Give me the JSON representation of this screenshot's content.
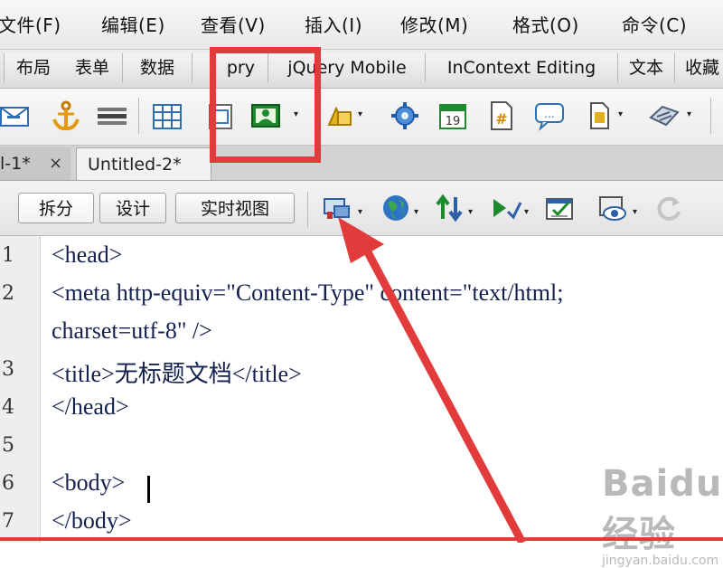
{
  "menu": [
    "文件(F)",
    "编辑(E)",
    "查看(V)",
    "插入(I)",
    "修改(M)",
    "格式(O)",
    "命令(C)"
  ],
  "insert_tabs": [
    "布局",
    "表单",
    "数据",
    "pry",
    "jQuery Mobile",
    "InContext Editing",
    "文本",
    "收藏"
  ],
  "toolbar_icons": [
    "email-link-icon",
    "named-anchor-icon",
    "horizontal-rule-icon",
    "table-icon",
    "insert-div-icon",
    "image-icon",
    "media-icon",
    "widget-icon",
    "date-icon",
    "server-side-include-icon",
    "comment-icon",
    "head-icon",
    "script-icon"
  ],
  "doc_tabs": [
    {
      "label": "l-1*",
      "close": "×"
    },
    {
      "label": "Untitled-2*"
    }
  ],
  "view_buttons": [
    "拆分",
    "设计",
    "实时视图"
  ],
  "view_icons": [
    "multiscreen-icon",
    "preview-browser-icon",
    "file-management-icon",
    "w3c-validation-icon",
    "check-browser-icon",
    "visual-aids-icon",
    "refresh-icon"
  ],
  "code": {
    "line_numbers": [
      "1",
      "2",
      "",
      "3",
      "4",
      "5",
      "6",
      "7"
    ],
    "lines": [
      "<head>",
      "<meta http-equiv=\"Content-Type\" content=\"text/html;",
      "charset=utf-8\" />",
      "<title>无标题文档</title>",
      "</head>",
      "",
      "<body>",
      "</body>"
    ]
  },
  "watermark": {
    "brand": "Baidu经验",
    "url": "jingyan.baidu.com"
  },
  "colors": {
    "annotation": "#e23b3b",
    "code_text": "#14204d"
  }
}
